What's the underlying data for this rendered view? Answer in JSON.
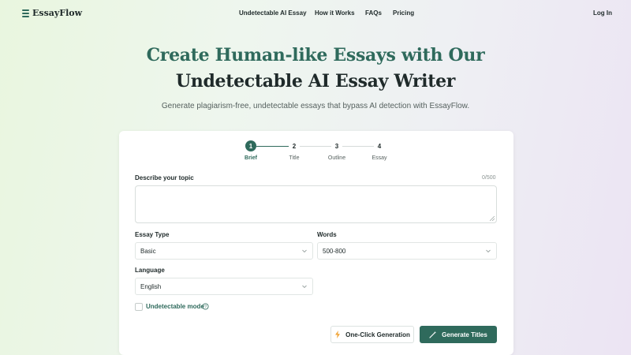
{
  "brand": {
    "name": "EssayFlow",
    "accent": "#2f6a5c"
  },
  "nav": {
    "links": [
      "Undetectable AI Essay",
      "How it Works",
      "FAQs",
      "Pricing"
    ],
    "login": "Log In"
  },
  "hero": {
    "title_line1": "Create Human-like Essays with Our",
    "title_line2": "Undetectable AI Essay Writer",
    "subtitle": "Generate plagiarism-free, undetectable essays that bypass AI detection with EssayFlow."
  },
  "stepper": {
    "current": 1,
    "steps": [
      {
        "number": "1",
        "label": "Brief"
      },
      {
        "number": "2",
        "label": "Title"
      },
      {
        "number": "3",
        "label": "Outline"
      },
      {
        "number": "4",
        "label": "Essay"
      }
    ]
  },
  "form": {
    "topic": {
      "label": "Describe your topic",
      "value": "",
      "counter": "0/500"
    },
    "essay_type": {
      "label": "Essay Type",
      "selected": "Basic"
    },
    "words": {
      "label": "Words",
      "selected": "500-800"
    },
    "language": {
      "label": "Language",
      "selected": "English"
    },
    "undetectable_mode": {
      "label": "Undetectable mode",
      "checked": false
    }
  },
  "actions": {
    "one_click": "One-Click Generation",
    "generate": "Generate Titles"
  },
  "icons": {
    "logo": "logo-stack-icon",
    "chevron": "chevron-down-icon",
    "help": "help-circle-icon",
    "bolt": "lightning-icon",
    "wand": "magic-wand-icon"
  }
}
